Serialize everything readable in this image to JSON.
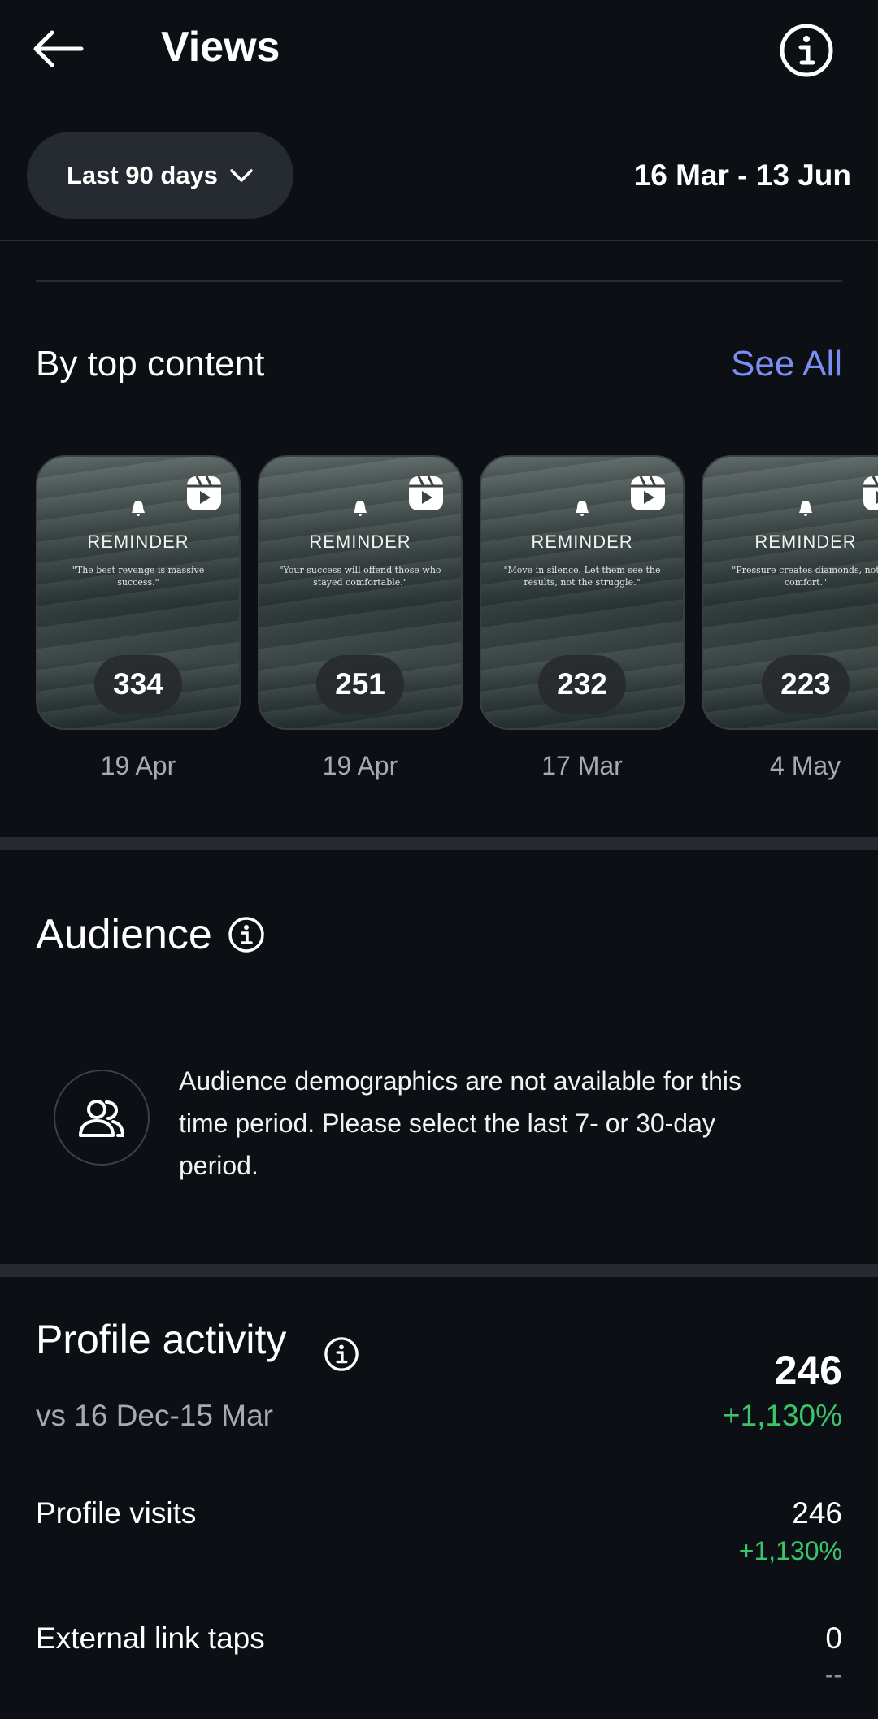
{
  "header": {
    "title": "Views"
  },
  "filter": {
    "range_label": "Last 90 days",
    "date_range": "16 Mar - 13 Jun"
  },
  "top_content": {
    "title": "By top content",
    "see_all": "See All",
    "items": [
      {
        "heading": "REMINDER",
        "quote": "\"The best revenge is massive success.\"",
        "count": "334",
        "date": "19 Apr"
      },
      {
        "heading": "REMINDER",
        "quote": "\"Your success will offend those who stayed comfortable.\"",
        "count": "251",
        "date": "19 Apr"
      },
      {
        "heading": "REMINDER",
        "quote": "\"Move in silence. Let them see the results, not the struggle.\"",
        "count": "232",
        "date": "17 Mar"
      },
      {
        "heading": "REMINDER",
        "quote": "\"Pressure creates diamonds, not comfort.\"",
        "count": "223",
        "date": "4 May"
      }
    ]
  },
  "audience": {
    "title": "Audience",
    "message": "Audience demographics are not available for this time period. Please select the last 7- or 30-day period."
  },
  "profile_activity": {
    "title": "Profile activity",
    "comparison": "vs 16 Dec-15 Mar",
    "total": "246",
    "total_change": "+1,130%",
    "rows": [
      {
        "label": "Profile visits",
        "value": "246",
        "change": "+1,130%"
      },
      {
        "label": "External link taps",
        "value": "0",
        "change": "--"
      }
    ]
  },
  "colors": {
    "background": "#0c0f14",
    "accent_link": "#7b8cf5",
    "positive": "#3cc46b",
    "muted_text": "#a6abb2"
  }
}
